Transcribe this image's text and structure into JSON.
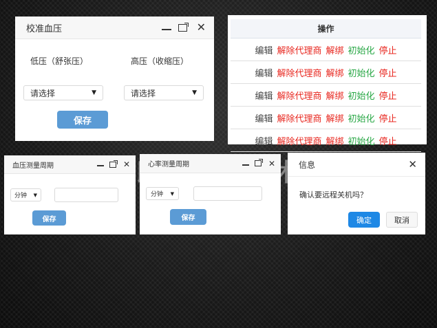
{
  "calibrate_dialog": {
    "title": "校准血压",
    "low_label": "低压（舒张压）",
    "high_label": "高压（收缩压）",
    "low_select": "请选择",
    "high_select": "请选择",
    "save": "保存"
  },
  "ops_table": {
    "header": "操作",
    "rows": [
      {
        "edit": "编辑",
        "unbind_agent": "解除代理商",
        "unbind": "解绑",
        "init": "初始化",
        "stop": "停止"
      },
      {
        "edit": "编辑",
        "unbind_agent": "解除代理商",
        "unbind": "解绑",
        "init": "初始化",
        "stop": "停止"
      },
      {
        "edit": "编辑",
        "unbind_agent": "解除代理商",
        "unbind": "解绑",
        "init": "初始化",
        "stop": "停止"
      },
      {
        "edit": "编辑",
        "unbind_agent": "解除代理商",
        "unbind": "解绑",
        "init": "初始化",
        "stop": "停止"
      },
      {
        "edit": "编辑",
        "unbind_agent": "解除代理商",
        "unbind": "解绑",
        "init": "初始化",
        "stop": "停止"
      }
    ]
  },
  "bp_period_dialog": {
    "title": "血压测量周期",
    "unit": "分钟",
    "input_value": "",
    "save": "保存"
  },
  "hr_period_dialog": {
    "title": "心率测量周期",
    "unit": "分钟",
    "input_value": "",
    "save": "保存"
  },
  "info_dialog": {
    "title": "信息",
    "message": "确认要远程关机吗？",
    "confirm": "确定",
    "cancel": "取消"
  },
  "watermark": "深圳市即爱医疗技术有限公司"
}
